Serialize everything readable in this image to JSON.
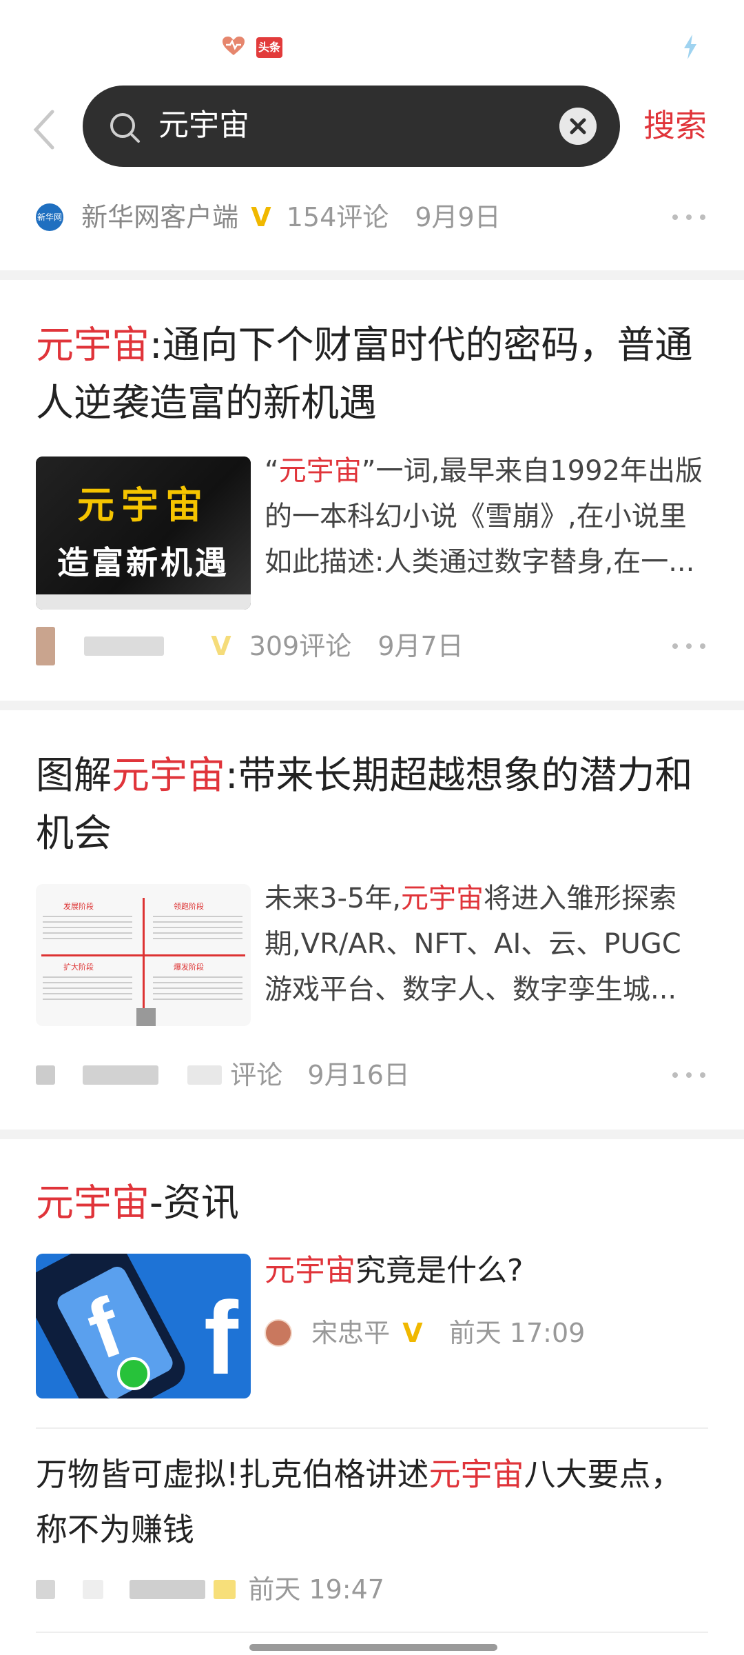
{
  "search": {
    "query": "元宇宙",
    "search_button": "搜索"
  },
  "item1": {
    "source": "新华网客户端",
    "source_logo_text": "新华网",
    "comments": "154评论",
    "date": "9月9日"
  },
  "item2": {
    "title_hl": "元宇宙",
    "title_rest": ":通向下个财富时代的密码，普通人逆袭造富的新机遇",
    "summary_pre": "“",
    "summary_hl": "元宇宙",
    "summary_rest": "”一词,最早来自1992年出版的一本科幻小说《雪崩》,在小说里如此描述:人类通过数字替身,在一...",
    "thumb_line1": "元宇宙",
    "thumb_line2": "造富新机遇",
    "comments": "309评论",
    "date": "9月7日"
  },
  "item3": {
    "title_pre": "图解",
    "title_hl": "元宇宙",
    "title_rest": ":带来长期超越想象的潜力和机会",
    "summary_pre": "未来3-5年,",
    "summary_hl": "元宇宙",
    "summary_rest": "将进入雏形探索期,VR/AR、NFT、AI、云、PUGC游戏平台、数字人、数字孪生城...",
    "thumb_labels": [
      "发展阶段",
      "领跑阶段",
      "扩大阶段",
      "爆发阶段"
    ],
    "comments_tail": "评论",
    "date": "9月16日"
  },
  "section": {
    "title_hl": "元宇宙",
    "title_rest": "-资讯",
    "card_title_hl": "元宇宙",
    "card_title_rest": "究竟是什么?",
    "author": "宋忠平",
    "time": "前天 17:09",
    "thumb_letter": "f"
  },
  "item5": {
    "title_pre": "万物皆可虚拟!扎克伯格讲述",
    "title_hl": "元宇宙",
    "title_rest": "八大要点，称不为赚钱",
    "time": "前天 19:47"
  },
  "colors": {
    "accent": "#e0343a",
    "search_bg": "#2f2f2f",
    "verified": "#f0b800"
  },
  "icons": [
    "back-arrow-icon",
    "search-icon",
    "clear-icon",
    "more-icon",
    "verified-icon",
    "heart-icon",
    "bolt-icon"
  ]
}
